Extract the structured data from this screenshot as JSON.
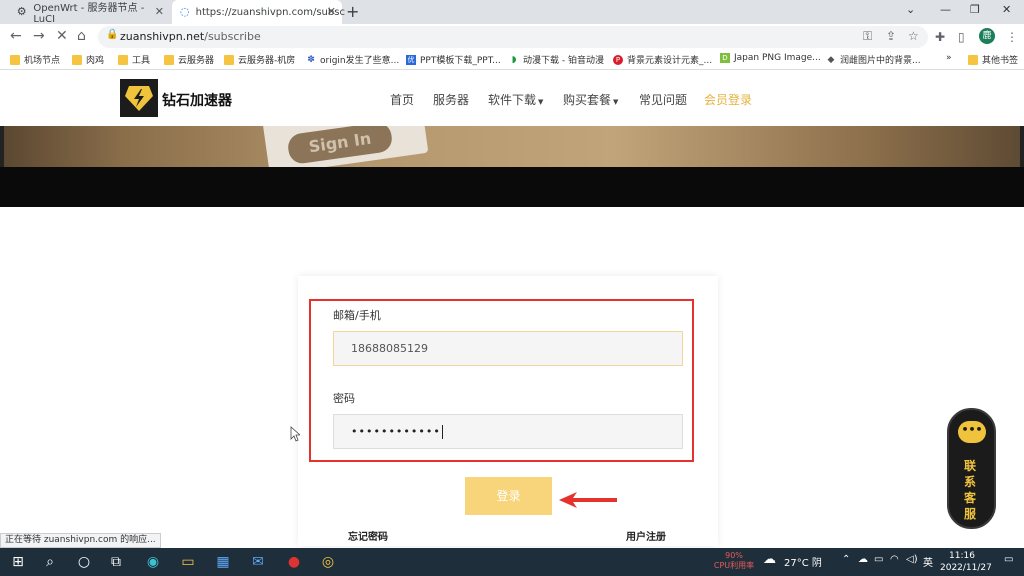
{
  "browser": {
    "tabs": [
      {
        "title": "OpenWrt - 服务器节点 - LuCI",
        "active": false
      },
      {
        "title": "https://zuanshivpn.com/subsc",
        "active": true
      }
    ],
    "url_host": "zuanshivpn.net",
    "url_path": "/subscribe",
    "profile_initial": "鹿",
    "bookmarks": [
      {
        "label": "机场节点",
        "icon": "folder-icon"
      },
      {
        "label": "肉鸡",
        "icon": "folder-icon"
      },
      {
        "label": "工具",
        "icon": "folder-icon"
      },
      {
        "label": "云服务器",
        "icon": "folder-icon"
      },
      {
        "label": "云服务器-机房",
        "icon": "folder-icon"
      },
      {
        "label": "origin发生了些意...",
        "icon": "paw-icon"
      },
      {
        "label": "PPT模板下载_PPT...",
        "icon": "ppt-icon"
      },
      {
        "label": "动漫下载 - 铂音动漫",
        "icon": "leaf-icon"
      },
      {
        "label": "背景元素设计元素_...",
        "icon": "p-icon"
      },
      {
        "label": "Japan PNG Image...",
        "icon": "d-icon"
      },
      {
        "label": "润雌图片中的背景...",
        "icon": "hat-icon"
      }
    ],
    "bookmarks_more": "»",
    "other_bookmarks": "其他书签"
  },
  "site": {
    "brand": "钻石加速器",
    "nav": [
      {
        "label": "首页",
        "dropdown": false,
        "active": false
      },
      {
        "label": "服务器",
        "dropdown": false,
        "active": false
      },
      {
        "label": "软件下载",
        "dropdown": true,
        "active": false
      },
      {
        "label": "购买套餐",
        "dropdown": true,
        "active": false
      },
      {
        "label": "常见问题",
        "dropdown": false,
        "active": false
      },
      {
        "label": "会员登录",
        "dropdown": false,
        "active": true
      }
    ],
    "hero_text": "Sign In"
  },
  "login": {
    "account_label": "邮箱/手机",
    "account_value": "18688085129",
    "password_label": "密码",
    "password_value": "••••••••••••",
    "submit_label": "登录",
    "forgot_label": "忘记密码",
    "register_label": "用户注册"
  },
  "chat_widget": {
    "label": "联系客服",
    "icon": "chat-icon"
  },
  "status_text": "正在等待 zuanshivpn.com 的响应...",
  "taskbar": {
    "cpu_percent": "90%",
    "cpu_label": "CPU利用率",
    "weather": "27°C 阴",
    "ime": "英",
    "time": "11:16",
    "date": "2022/11/27"
  },
  "colors": {
    "accent_gold": "#e3b341",
    "button_gold": "#f8d57a",
    "highlight_red": "#e5322d"
  }
}
